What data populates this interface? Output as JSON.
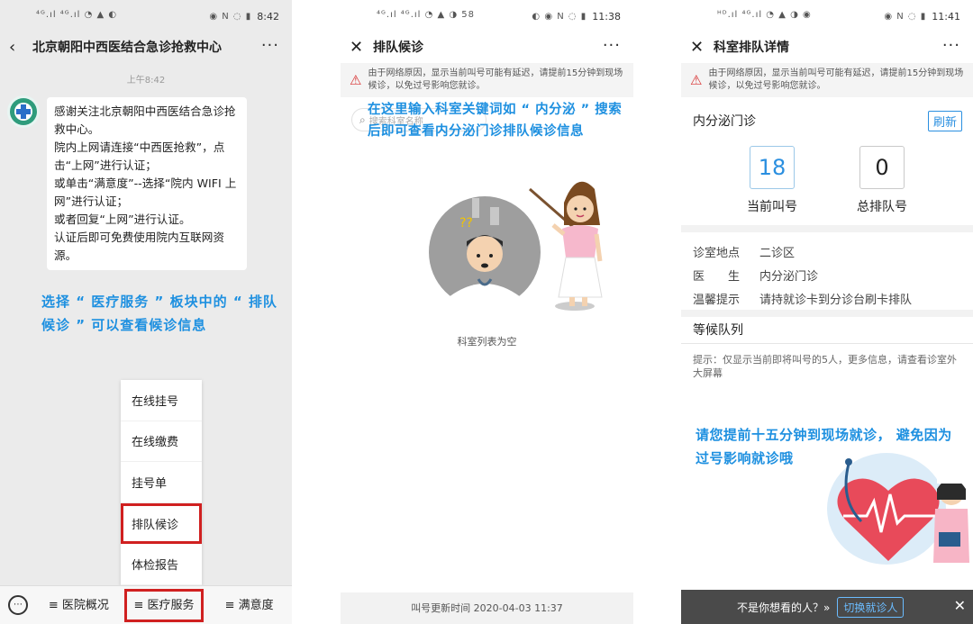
{
  "panel1": {
    "status_time": "8:42",
    "title": "北京朝阳中西医结合急诊抢救中心",
    "more": "···",
    "timestamp": "上午8:42",
    "message_lines": [
      "感谢关注北京朝阳中西医结合急诊抢救中心。",
      "院内上网请连接“中西医抢救”，点击“上网”进行认证；",
      "或单击“满意度”--选择“院内 WIFI 上网”进行认证；",
      "或者回复“上网”进行认证。",
      "认证后即可免费使用院内互联网资源。"
    ],
    "annotation": "选择 “ 医疗服务 ” 板块中的 “ 排队候诊 ” 可以查看候诊信息",
    "menu": [
      "在线挂号",
      "在线缴费",
      "挂号单",
      "排队候诊",
      "体检报告"
    ],
    "tabs": [
      "≡ 医院概况",
      "≡ 医疗服务",
      "≡ 满意度"
    ],
    "keyboard_icon": "keyboard-icon"
  },
  "panel2": {
    "status_time": "11:38",
    "title": "排队候诊",
    "more": "···",
    "warning": "由于网络原因，显示当前叫号可能有延迟，请提前15分钟到现场候诊，以免过号影响您就诊。",
    "search_placeholder": "搜索科室名称",
    "annotation": "在这里输入科室关键词如 “ 内分泌 ” 搜索后即可查看内分泌门诊排队候诊信息",
    "empty_text": "科室列表为空",
    "footer": "叫号更新时间 2020-04-03 11:37"
  },
  "panel3": {
    "status_time": "11:41",
    "title": "科室排队详情",
    "more": "···",
    "warning": "由于网络原因，显示当前叫号可能有延迟，请提前15分钟到现场候诊，以免过号影响您就诊。",
    "department": "内分泌门诊",
    "refresh": "刷新",
    "current_number": "18",
    "current_label": "当前叫号",
    "total_number": "0",
    "total_label": "总排队号",
    "info": [
      {
        "k": "诊室地点",
        "v": "二诊区"
      },
      {
        "k": "医　　生",
        "v": "内分泌门诊"
      },
      {
        "k": "温馨提示",
        "v": "请持就诊卡到分诊台刷卡排队"
      }
    ],
    "queue_title": "等候队列",
    "tip": "提示：仅显示当前即将叫号的5人，更多信息，请查看诊室外大屏幕",
    "reminder": "请您提前十五分钟到现场就诊， 避免因为过号影响就诊哦",
    "bottom_question": "不是你想看的人？»",
    "switch_button": "切换就诊人",
    "close": "✕"
  },
  "colors": {
    "accent_blue": "#1e90e0",
    "highlight_red": "#d02020",
    "warning_red": "#d83030"
  }
}
